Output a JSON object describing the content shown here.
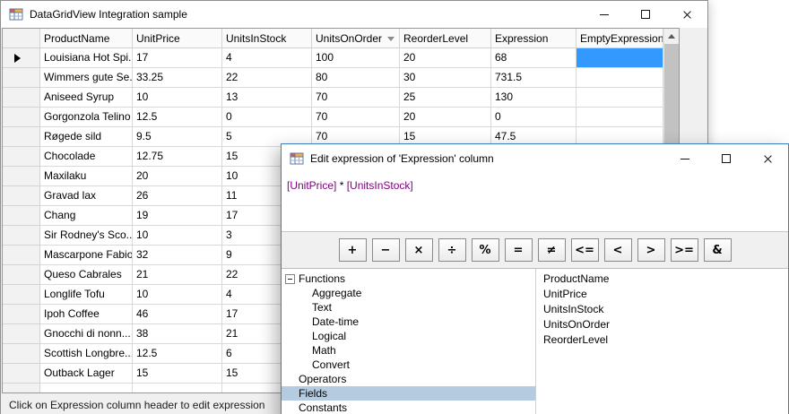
{
  "main_window": {
    "title": "DataGridView Integration sample",
    "status_text": "Click on Expression column header to edit expression",
    "grid": {
      "columns": [
        "ProductName",
        "UnitPrice",
        "UnitsInStock",
        "UnitsOnOrder",
        "ReorderLevel",
        "Expression",
        "EmptyExpression"
      ],
      "sorted_column": "UnitsOnOrder",
      "rows": [
        {
          "cells": [
            "Louisiana Hot Spi...",
            "17",
            "4",
            "100",
            "20",
            "68",
            ""
          ],
          "current": true,
          "selected_cell": 6
        },
        {
          "cells": [
            "Wimmers gute Se...",
            "33.25",
            "22",
            "80",
            "30",
            "731.5",
            ""
          ]
        },
        {
          "cells": [
            "Aniseed Syrup",
            "10",
            "13",
            "70",
            "25",
            "130",
            ""
          ]
        },
        {
          "cells": [
            "Gorgonzola Telino",
            "12.5",
            "0",
            "70",
            "20",
            "0",
            ""
          ]
        },
        {
          "cells": [
            "Røgede sild",
            "9.5",
            "5",
            "70",
            "15",
            "47.5",
            ""
          ]
        },
        {
          "cells": [
            "Chocolade",
            "12.75",
            "15",
            "",
            "",
            "",
            ""
          ]
        },
        {
          "cells": [
            "Maxilaku",
            "20",
            "10",
            "",
            "",
            "",
            ""
          ]
        },
        {
          "cells": [
            "Gravad lax",
            "26",
            "11",
            "",
            "",
            "",
            ""
          ]
        },
        {
          "cells": [
            "Chang",
            "19",
            "17",
            "",
            "",
            "",
            ""
          ]
        },
        {
          "cells": [
            "Sir Rodney's Sco...",
            "10",
            "3",
            "",
            "",
            "",
            ""
          ]
        },
        {
          "cells": [
            "Mascarpone Fabioli",
            "32",
            "9",
            "",
            "",
            "",
            ""
          ]
        },
        {
          "cells": [
            "Queso Cabrales",
            "21",
            "22",
            "",
            "",
            "",
            ""
          ]
        },
        {
          "cells": [
            "Longlife Tofu",
            "10",
            "4",
            "",
            "",
            "",
            ""
          ]
        },
        {
          "cells": [
            "Ipoh Coffee",
            "46",
            "17",
            "",
            "",
            "",
            ""
          ]
        },
        {
          "cells": [
            "Gnocchi di nonn...",
            "38",
            "21",
            "",
            "",
            "",
            ""
          ]
        },
        {
          "cells": [
            "Scottish Longbre...",
            "12.5",
            "6",
            "",
            "",
            "",
            ""
          ]
        },
        {
          "cells": [
            "Outback Lager",
            "15",
            "15",
            "",
            "",
            "",
            ""
          ]
        }
      ]
    }
  },
  "dialog": {
    "title": "Edit expression of 'Expression' column",
    "expression_tokens": [
      {
        "text": "[UnitPrice]",
        "type": "field"
      },
      {
        "text": " * ",
        "type": "operator"
      },
      {
        "text": "[UnitsInStock]",
        "type": "field"
      }
    ],
    "operator_buttons": [
      "+",
      "−",
      "×",
      "÷",
      "%",
      "=",
      "≠",
      "<=",
      "<",
      ">",
      ">=",
      "&"
    ],
    "tree": [
      {
        "label": "Functions",
        "level": 0,
        "expander": "minus"
      },
      {
        "label": "Aggregate",
        "level": 1
      },
      {
        "label": "Text",
        "level": 1
      },
      {
        "label": "Date-time",
        "level": 1
      },
      {
        "label": "Logical",
        "level": 1
      },
      {
        "label": "Math",
        "level": 1
      },
      {
        "label": "Convert",
        "level": 1
      },
      {
        "label": "Operators",
        "level": 0
      },
      {
        "label": "Fields",
        "level": 0,
        "selected": true
      },
      {
        "label": "Constants",
        "level": 0
      }
    ],
    "fields_list": [
      "ProductName",
      "UnitPrice",
      "UnitsInStock",
      "UnitsOnOrder",
      "ReorderLevel"
    ]
  },
  "colors": {
    "selection_blue": "#3399ff",
    "tree_selection": "#b5cbdf",
    "field_token": "#800080",
    "dialog_border": "#3e7bbf"
  }
}
